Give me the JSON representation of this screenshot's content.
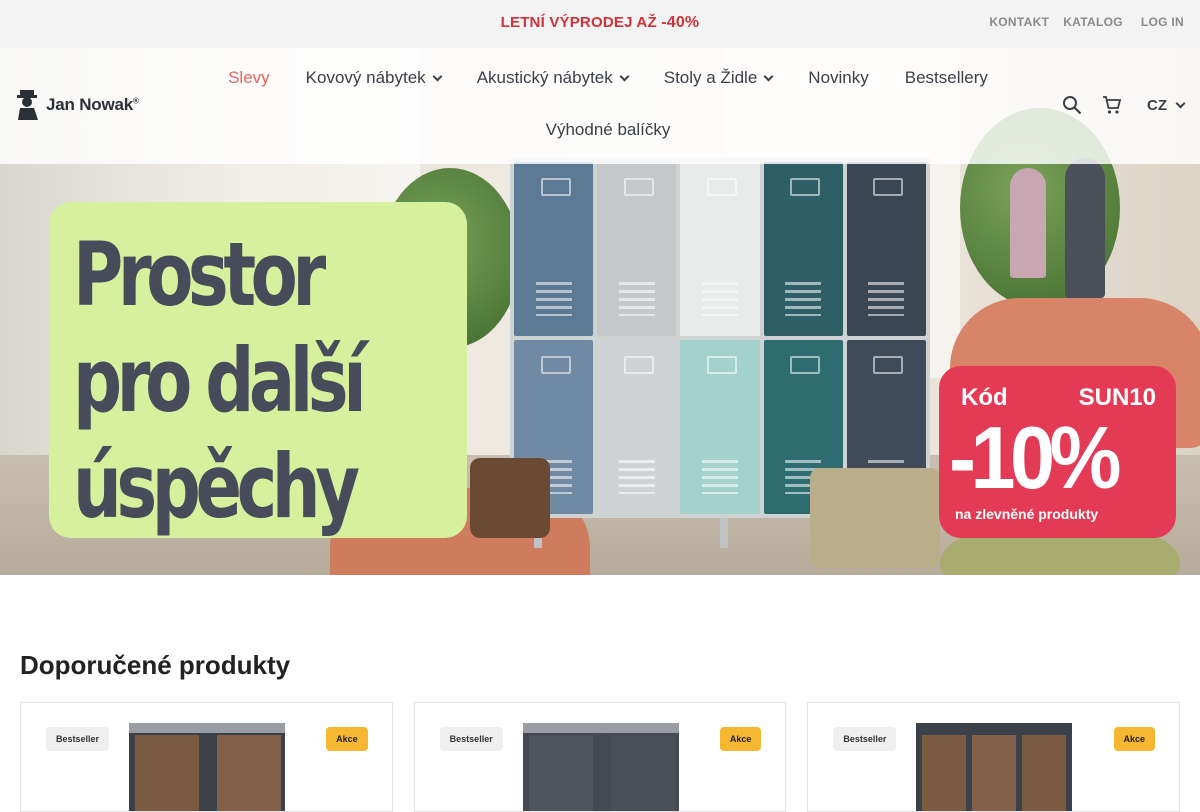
{
  "promo": {
    "text": "LETNÍ VÝPRODEJ AŽ",
    "percent": "-40%"
  },
  "utility_links": {
    "contact": "KONTAKT",
    "catalog": "KATALOG",
    "login": "LOG IN"
  },
  "logo": {
    "text": "Jan Nowak",
    "mark": "®"
  },
  "menu": {
    "items": [
      {
        "label": "Slevy",
        "dropdown": false,
        "active": true
      },
      {
        "label": "Kovový nábytek",
        "dropdown": true
      },
      {
        "label": "Akustický nábytek",
        "dropdown": true
      },
      {
        "label": "Stoly a Židle",
        "dropdown": true
      },
      {
        "label": "Novinky",
        "dropdown": false
      },
      {
        "label": "Bestsellery",
        "dropdown": false
      },
      {
        "label": "Výhodné balíčky",
        "dropdown": false
      }
    ]
  },
  "header_icons": {
    "search": "search-icon",
    "cart": "cart-icon",
    "language": "CZ"
  },
  "hero": {
    "headline": [
      "Prostor",
      "pro další",
      "úspěchy"
    ],
    "code_label": "Kód",
    "code_value": "SUN10",
    "discount": "-10%",
    "discount_note": "na zlevněné produkty"
  },
  "section": {
    "title": "Doporučené produkty"
  },
  "products": [
    {
      "badge_left": "Bestseller",
      "badge_right": "Akce",
      "finish": "wood"
    },
    {
      "badge_left": "Bestseller",
      "badge_right": "Akce",
      "finish": "graphite"
    },
    {
      "badge_left": "Bestseller",
      "badge_right": "Akce",
      "finish": "wood-triple"
    }
  ],
  "colors": {
    "promo_red": "#d0323c",
    "active_menu": "#e2645c",
    "hero_card": "#d6f09e",
    "code_card": "#e33a55",
    "sale_badge": "#f5b731"
  }
}
